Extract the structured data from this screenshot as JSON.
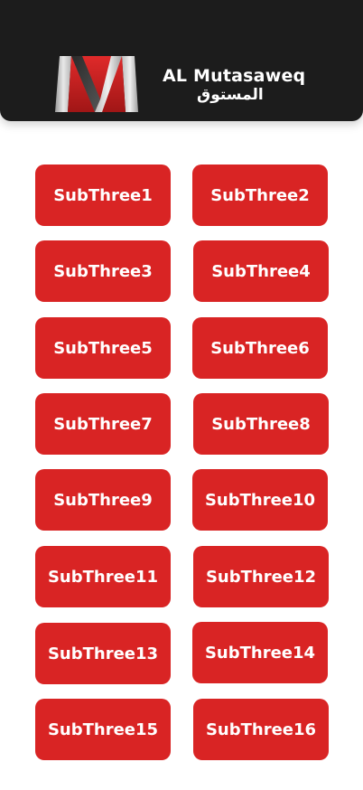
{
  "header": {
    "brand_name": "AL Mutasaweq",
    "brand_name_ar": "المستوق",
    "logo_icon": "m-letter-logo-icon",
    "background_color": "#1c1c1c"
  },
  "buttons": {
    "color": "#d92424",
    "items": [
      {
        "label": "SubThree1"
      },
      {
        "label": "SubThree2"
      },
      {
        "label": "SubThree3"
      },
      {
        "label": "SubThree4"
      },
      {
        "label": "SubThree5"
      },
      {
        "label": "SubThree6"
      },
      {
        "label": "SubThree7"
      },
      {
        "label": "SubThree8"
      },
      {
        "label": "SubThree9"
      },
      {
        "label": "SubThree10"
      },
      {
        "label": "SubThree11"
      },
      {
        "label": "SubThree12"
      },
      {
        "label": "SubThree13"
      },
      {
        "label": "SubThree14"
      },
      {
        "label": "SubThree15"
      },
      {
        "label": "SubThree16"
      }
    ]
  }
}
